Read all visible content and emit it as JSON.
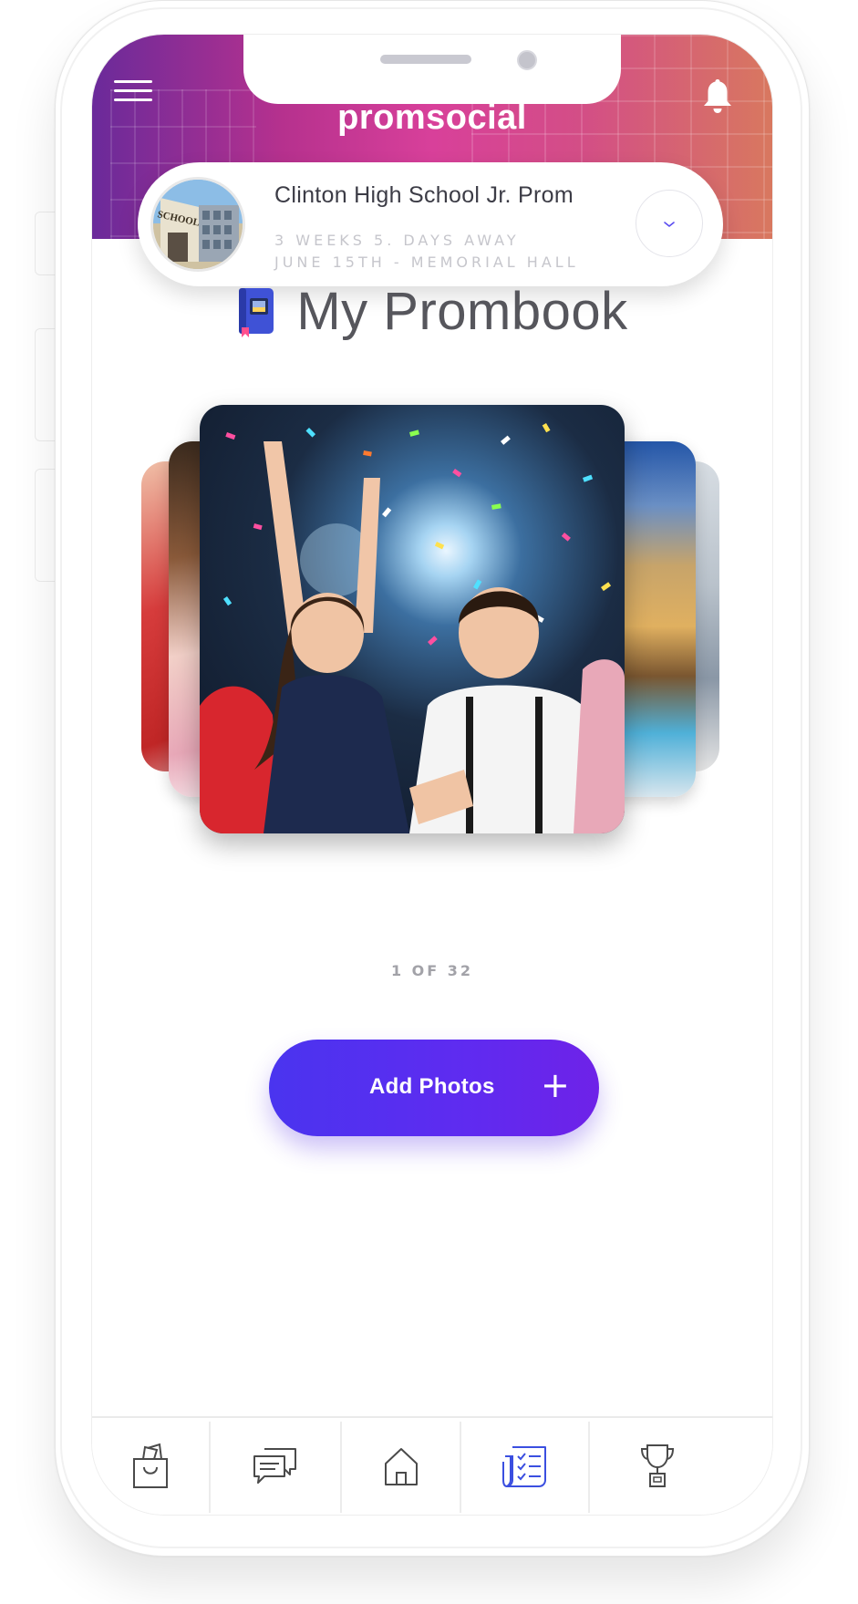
{
  "header": {
    "brand": "promsocial",
    "menu_icon": "hamburger-menu-icon",
    "notification_icon": "bell-icon"
  },
  "event": {
    "title": "Clinton High School Jr. Prom",
    "countdown": "3 WEEKS  5. DAYS AWAY",
    "details": "JUNE 15TH -  MEMORIAL  HALL",
    "image_sign_text": "SCHOOL",
    "dropdown_icon": "chevron-down-icon"
  },
  "prombook": {
    "title": "My Prombook",
    "icon": "book-icon",
    "counter": "1 OF 32"
  },
  "actions": {
    "add_photos_label": "Add Photos",
    "add_photos_icon": "+"
  },
  "tabs": [
    {
      "name": "shop",
      "icon": "shopping-bag-icon",
      "active": false
    },
    {
      "name": "messages",
      "icon": "chat-bubbles-icon",
      "active": false
    },
    {
      "name": "home",
      "icon": "home-icon",
      "active": false
    },
    {
      "name": "checklist",
      "icon": "checklist-icon",
      "active": true
    },
    {
      "name": "awards",
      "icon": "trophy-icon",
      "active": false
    }
  ],
  "colors": {
    "accent": "#4f33ee",
    "active_tab": "#3b4fe0",
    "inactive_tab": "#4a4a4a",
    "header_gradient_start": "#6a2a9a",
    "header_gradient_mid": "#d8409a",
    "header_gradient_end": "#d8785f"
  }
}
